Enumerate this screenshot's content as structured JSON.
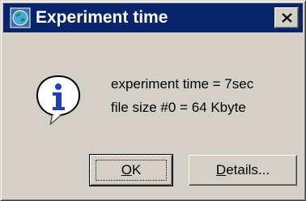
{
  "window": {
    "title": "Experiment time",
    "icon": "app-globe-icon",
    "close_icon": "close-icon"
  },
  "message": {
    "icon": "info-icon",
    "line1": "experiment time = 7sec",
    "line2": "file size #0 = 64 Kbyte"
  },
  "buttons": {
    "ok": {
      "label": "OK",
      "mnemonic": "O",
      "rest": "K"
    },
    "details": {
      "label": "Details...",
      "mnemonic": "D",
      "rest": "etails..."
    }
  },
  "colors": {
    "titlebar": "#0a246a",
    "face": "#d4d0c8",
    "info_blue": "#1f3fbf"
  }
}
